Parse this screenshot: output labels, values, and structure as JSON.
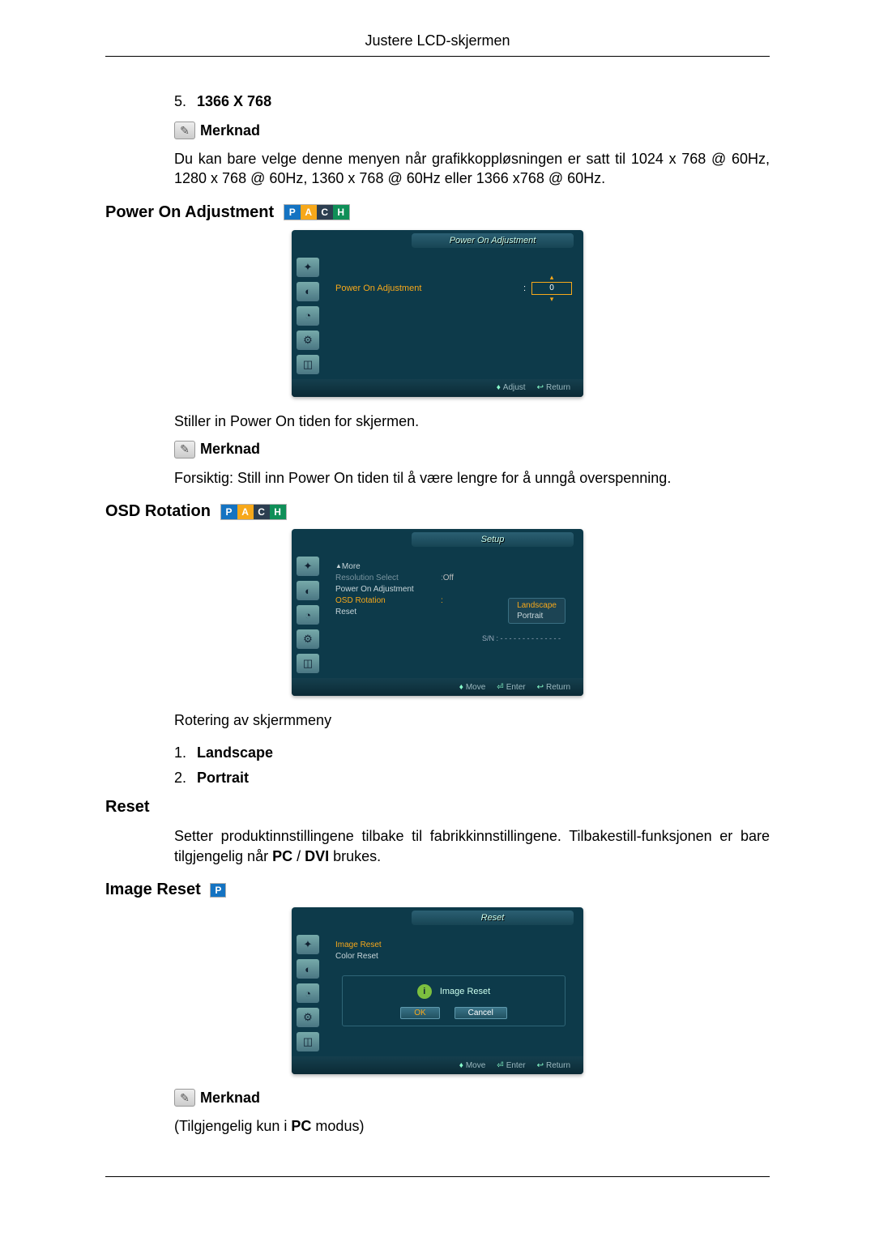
{
  "header": {
    "title": "Justere LCD-skjermen"
  },
  "resItem": {
    "num": "5.",
    "label": "1366 X 768"
  },
  "note1": {
    "label": "Merknad",
    "text": "Du kan bare velge denne menyen når grafikkoppløsningen er satt til 1024 x 768 @ 60Hz, 1280 x 768 @ 60Hz, 1360 x 768 @ 60Hz eller 1366 x768 @ 60Hz."
  },
  "powerOn": {
    "title": "Power On Adjustment",
    "osdTitle": "Power On Adjustment",
    "rowLabel": "Power On Adjustment",
    "value": "0",
    "footer": {
      "adjust": "Adjust",
      "ret": "Return"
    },
    "desc": "Stiller in Power On tiden for skjermen.",
    "noteLabel": "Merknad",
    "noteText": "Forsiktig: Still inn Power On tiden til å være lengre for å unngå overspenning."
  },
  "osdRotation": {
    "title": "OSD Rotation",
    "osdTitle": "Setup",
    "menu": {
      "more": "More",
      "items": [
        {
          "label": "Resolution Select",
          "value": "Off"
        },
        {
          "label": "Power On Adjustment",
          "value": ""
        },
        {
          "label": "OSD Rotation",
          "value": "",
          "hl": true
        },
        {
          "label": "Reset",
          "value": ""
        }
      ],
      "submenu": {
        "opt1": "Landscape",
        "opt2": "Portrait"
      },
      "sn": "S/N : - - - - - - - - - - - - - -"
    },
    "footer": {
      "move": "Move",
      "enter": "Enter",
      "ret": "Return"
    },
    "desc": "Rotering av skjermmeny",
    "list": [
      {
        "num": "1.",
        "label": "Landscape"
      },
      {
        "num": "2.",
        "label": "Portrait"
      }
    ]
  },
  "reset": {
    "title": "Reset",
    "desc": "Setter produktinnstillingene tilbake til fabrikkinnstillingene. Tilbakestill-funksjonen er bare tilgjengelig når PC / DVI brukes."
  },
  "imageReset": {
    "title": "Image Reset",
    "osdTitle": "Reset",
    "menu": {
      "item1": "Image Reset",
      "item2": "Color Reset"
    },
    "dialog": {
      "title": "Image Reset",
      "ok": "OK",
      "cancel": "Cancel"
    },
    "footer": {
      "move": "Move",
      "enter": "Enter",
      "ret": "Return"
    },
    "noteLabel": "Merknad",
    "noteText": "(Tilgjengelig kun i PC modus)"
  },
  "pach": {
    "p": "P",
    "a": "A",
    "c": "C",
    "h": "H"
  }
}
